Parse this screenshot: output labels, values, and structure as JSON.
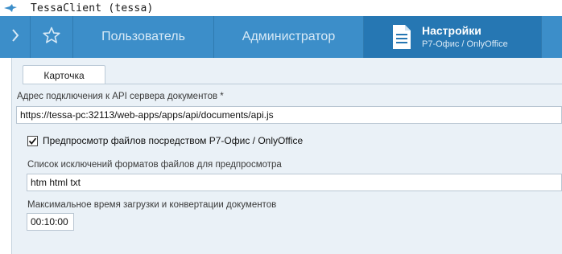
{
  "window": {
    "title": "TessaClient (tessa)"
  },
  "nav": {
    "back_icon": "chevron-right-icon",
    "favorite_icon": "star-outline-icon",
    "tabs": [
      {
        "label": "Пользователь"
      },
      {
        "label": "Администратор"
      }
    ],
    "active": {
      "title": "Настройки",
      "subtitle": "Р7-Офис / OnlyOffice",
      "icon": "document-icon"
    }
  },
  "card": {
    "tab_label": "Карточка",
    "api_address": {
      "label": "Адрес подключения к API сервера документов  *",
      "value": "https://tessa-pc:32113/web-apps/apps/api/documents/api.js"
    },
    "preview": {
      "label": "Предпросмотр файлов посредством Р7-Офис / OnlyOffice",
      "checked": true
    },
    "exclusions": {
      "label": "Список исключений форматов файлов для предпросмотра",
      "value": "htm html txt"
    },
    "max_time": {
      "label": "Максимальное время загрузки и конвертации документов",
      "value": "00:10:00"
    }
  },
  "colors": {
    "nav_bg": "#3c8ec9",
    "nav_active_bg": "#2677b3",
    "content_bg": "#eaf1f7"
  }
}
